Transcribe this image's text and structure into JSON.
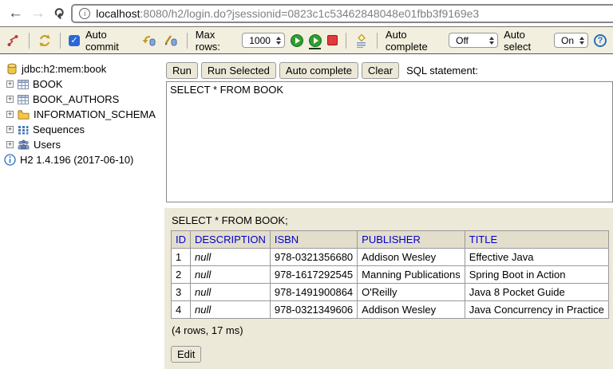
{
  "browser": {
    "url": {
      "host": "localhost",
      "rest": ":8080/h2/login.do?jsessionid=0823c1c53462848048e01fbb3f9169e3"
    },
    "info_glyph": "i"
  },
  "icons": {
    "disconnect": "red-broken-link",
    "refresh": "gold-circular-arrows",
    "commit": "gold-arrow-blue-db",
    "rollback": "pencil-blue-db",
    "run": "green-play",
    "run_selected": "green-play-underlined",
    "stop": "red-square",
    "autocomplete": "gold-diamond-blue-lines",
    "help_glyph": "?",
    "checkbox_glyph": "✓",
    "plus_glyph": "+"
  },
  "toolbar": {
    "auto_commit": {
      "label": "Auto commit",
      "checked": true
    },
    "max_rows": {
      "label": "Max rows:",
      "value": "1000"
    },
    "auto_complete": {
      "label": "Auto complete",
      "value": "Off"
    },
    "auto_select": {
      "label": "Auto select",
      "value": "On"
    }
  },
  "sidebar": {
    "connection": "jdbc:h2:mem:book",
    "items": [
      {
        "label": "BOOK",
        "icon": "table-icon"
      },
      {
        "label": "BOOK_AUTHORS",
        "icon": "table-icon"
      },
      {
        "label": "INFORMATION_SCHEMA",
        "icon": "folder-icon"
      },
      {
        "label": "Sequences",
        "icon": "sequences-icon"
      },
      {
        "label": "Users",
        "icon": "users-icon"
      }
    ],
    "version": "H2 1.4.196 (2017-06-10)"
  },
  "query": {
    "buttons": {
      "run": "Run",
      "run_selected": "Run Selected",
      "auto_complete": "Auto complete",
      "clear": "Clear"
    },
    "label": "SQL statement:",
    "sql": "SELECT * FROM BOOK"
  },
  "result": {
    "echo": "SELECT * FROM BOOK;",
    "columns": [
      "ID",
      "DESCRIPTION",
      "ISBN",
      "PUBLISHER",
      "TITLE"
    ],
    "rows": [
      [
        "1",
        "null",
        "978-0321356680",
        "Addison Wesley",
        "Effective Java"
      ],
      [
        "2",
        "null",
        "978-1617292545",
        "Manning Publications",
        "Spring Boot in Action"
      ],
      [
        "3",
        "null",
        "978-1491900864",
        "O'Reilly",
        "Java 8 Pocket Guide"
      ],
      [
        "4",
        "null",
        "978-0321349606",
        "Addison Wesley",
        "Java Concurrency in Practice"
      ]
    ],
    "status": "(4 rows, 17 ms)",
    "edit": "Edit"
  },
  "colors": {
    "toolbar_bg": "#f2efdf",
    "result_panel_bg": "#ece9d8",
    "table_header_bg": "#e2decb",
    "table_header_text": "#0000cc",
    "run_green": "#2f9e2f",
    "stop_red": "#e03c3c",
    "icon_blue": "#2a6fc0",
    "db_gold": "#f0c64a"
  }
}
